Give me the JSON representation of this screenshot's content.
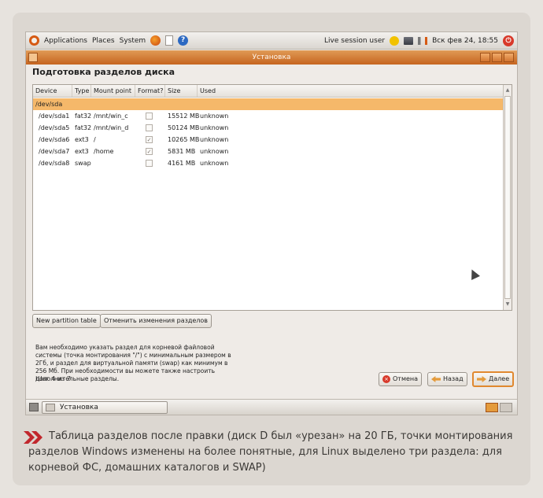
{
  "top_panel": {
    "menus": [
      "Applications",
      "Places",
      "System"
    ],
    "user": "Live session user",
    "datetime": "Вск фев 24, 18:55"
  },
  "window": {
    "title": "Установка",
    "heading": "Подготовка разделов диска"
  },
  "table": {
    "columns": [
      "Device",
      "Type",
      "Mount point",
      "Format?",
      "Size",
      "Used"
    ],
    "disk": "/dev/sda",
    "rows": [
      {
        "device": "/dev/sda1",
        "type": "fat32",
        "mount": "/mnt/win_c",
        "format": false,
        "size": "15512 MB",
        "used": "unknown"
      },
      {
        "device": "/dev/sda5",
        "type": "fat32",
        "mount": "/mnt/win_d",
        "format": false,
        "size": "50124 MB",
        "used": "unknown"
      },
      {
        "device": "/dev/sda6",
        "type": "ext3",
        "mount": "/",
        "format": true,
        "size": "10265 MB",
        "used": "unknown"
      },
      {
        "device": "/dev/sda7",
        "type": "ext3",
        "mount": "/home",
        "format": true,
        "size": "5831 MB",
        "used": "unknown"
      },
      {
        "device": "/dev/sda8",
        "type": "swap",
        "mount": "",
        "format": false,
        "size": "4161 MB",
        "used": "unknown"
      }
    ]
  },
  "buttons": {
    "new_table": "New partition table",
    "undo": "Отменить изменения разделов",
    "cancel": "Отмена",
    "back": "Назад",
    "forward": "Далее"
  },
  "info_text": "Вам необходимо указать раздел для корневой файловой системы (точка монтирования \"/\") с минимальным размером в 2Гб, и раздел для виртуальной памяти (swap) как минимум в 256 Мб. При необходимости вы можете также настроить дополнительные разделы.",
  "step_text": "Шаг 4 из 7",
  "taskbar": {
    "task": "Установка"
  },
  "caption": "Таблица разделов после правки (диск D был «урезан» на 20 ГБ, точки монтирования разделов Windows изменены на более понятные, для Linux выделено три раздела: для корневой ФС, домашних каталогов и SWAP)",
  "colors": {
    "accent": "#e0882f",
    "selected_row": "#f5b86a",
    "caption_marker": "#c1272d"
  }
}
